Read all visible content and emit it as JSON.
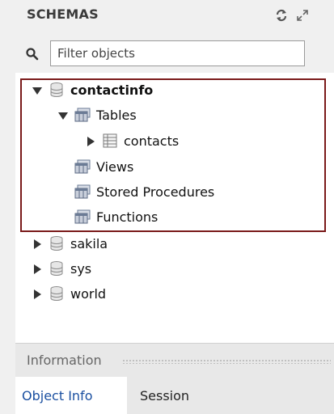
{
  "header": {
    "title": "SCHEMAS",
    "icons": [
      "refresh-icon",
      "expand-icon"
    ]
  },
  "filter": {
    "placeholder": "Filter objects",
    "value": "",
    "icon": "search-icon"
  },
  "tree": {
    "schemas": [
      {
        "name": "contactinfo",
        "expanded": true,
        "children": [
          {
            "name": "Tables",
            "expanded": true,
            "children": [
              {
                "name": "contacts",
                "expanded": false
              }
            ]
          },
          {
            "name": "Views"
          },
          {
            "name": "Stored Procedures"
          },
          {
            "name": "Functions"
          }
        ]
      },
      {
        "name": "sakila",
        "expanded": false
      },
      {
        "name": "sys",
        "expanded": false
      },
      {
        "name": "world",
        "expanded": false
      }
    ]
  },
  "highlight_color": "#7a1a1a",
  "info": {
    "title": "Information",
    "tabs": [
      {
        "label": "Object Info",
        "active": true
      },
      {
        "label": "Session",
        "active": false
      }
    ]
  },
  "colors": {
    "active_tab_text": "#1a4fa0",
    "panel_bg": "#f0f0f0"
  }
}
